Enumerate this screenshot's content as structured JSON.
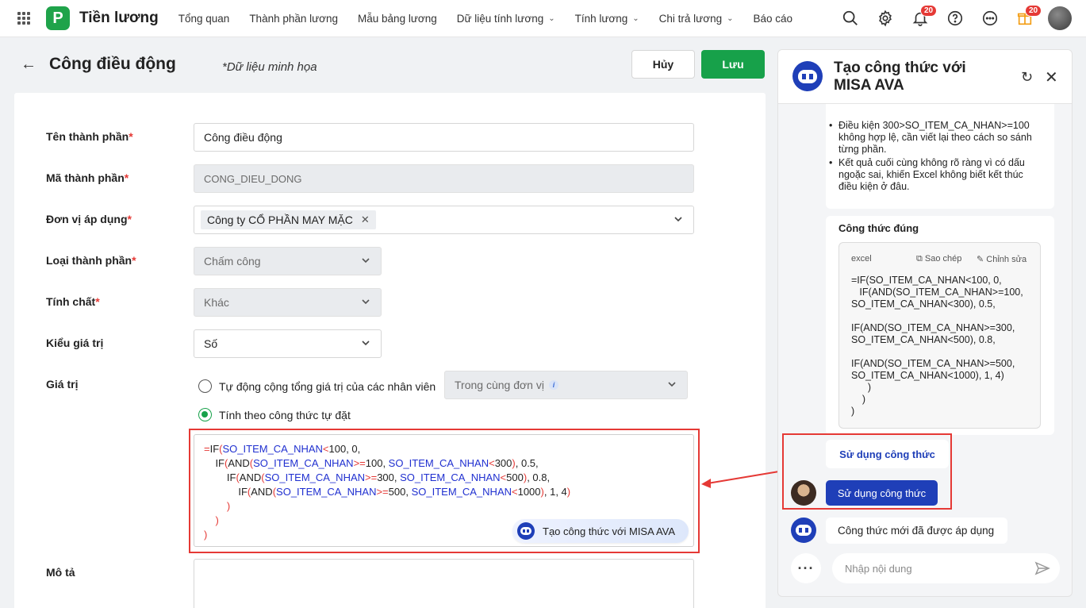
{
  "topbar": {
    "app_title": "Tiền lương",
    "logo_letter": "P",
    "nav": [
      {
        "label": "Tổng quan",
        "dropdown": false
      },
      {
        "label": "Thành phần lương",
        "dropdown": false
      },
      {
        "label": "Mẫu bảng lương",
        "dropdown": false
      },
      {
        "label": "Dữ liệu tính lương",
        "dropdown": true
      },
      {
        "label": "Tính lương",
        "dropdown": true
      },
      {
        "label": "Chi trả lương",
        "dropdown": true
      },
      {
        "label": "Báo cáo",
        "dropdown": false
      }
    ],
    "notif_badge": "20",
    "gift_badge": "20"
  },
  "page": {
    "title": "Công điều động",
    "demo_note": "*Dữ liệu minh họa",
    "cancel_label": "Hủy",
    "save_label": "Lưu"
  },
  "form": {
    "name_label": "Tên thành phần",
    "name_value": "Công điều động",
    "code_label": "Mã thành phần",
    "code_value": "CONG_DIEU_DONG",
    "unit_label": "Đơn vị áp dụng",
    "unit_chip": "Công ty CỔ PHẦN MAY MẶC",
    "type_label": "Loại thành phần",
    "type_value": "Chấm công",
    "nature_label": "Tính chất",
    "nature_value": "Khác",
    "valuetype_label": "Kiểu giá trị",
    "valuetype_value": "Số",
    "value_label": "Giá trị",
    "radio_auto_label": "Tự động cộng tổng giá trị của các nhân viên",
    "scope_value": "Trong cùng đơn vị",
    "radio_formula_label": "Tính theo công thức tự đặt",
    "ava_button": "Tạo công thức với MISA AVA",
    "desc_label": "Mô tả",
    "required_mark": "*"
  },
  "panel": {
    "title": "Tạo công thức với MISA AVA",
    "bullets": [
      "Điều kiện 300>SO_ITEM_CA_NHAN>=100 không hợp lệ, cần viết lại theo cách so sánh từng phần.",
      "Kết quả cuối cùng không rõ ràng vì có dấu ngoặc sai, khiến Excel không biết kết thúc điều kiện ở đâu."
    ],
    "correct_title": "Công thức đúng",
    "code_lang": "excel",
    "copy_label": "Sao chép",
    "edit_label": "Chỉnh sửa",
    "code": "=IF(SO_ITEM_CA_NHAN<100, 0,\n   IF(AND(SO_ITEM_CA_NHAN>=100,\nSO_ITEM_CA_NHAN<300), 0.5,\n\nIF(AND(SO_ITEM_CA_NHAN>=300,\nSO_ITEM_CA_NHAN<500), 0.8,\n\nIF(AND(SO_ITEM_CA_NHAN>=500,\nSO_ITEM_CA_NHAN<1000), 1, 4)\n      )\n    )\n)",
    "use_formula_bubble": "Sử dụng công thức",
    "use_formula_button": "Sử dụng công thức",
    "applied_message": "Công thức mới đã được áp dụng",
    "input_placeholder": "Nhập nội dung"
  },
  "colors": {
    "brand_green": "#17a14a",
    "ava_blue": "#1f3fb8",
    "highlight_red": "#e53935"
  }
}
